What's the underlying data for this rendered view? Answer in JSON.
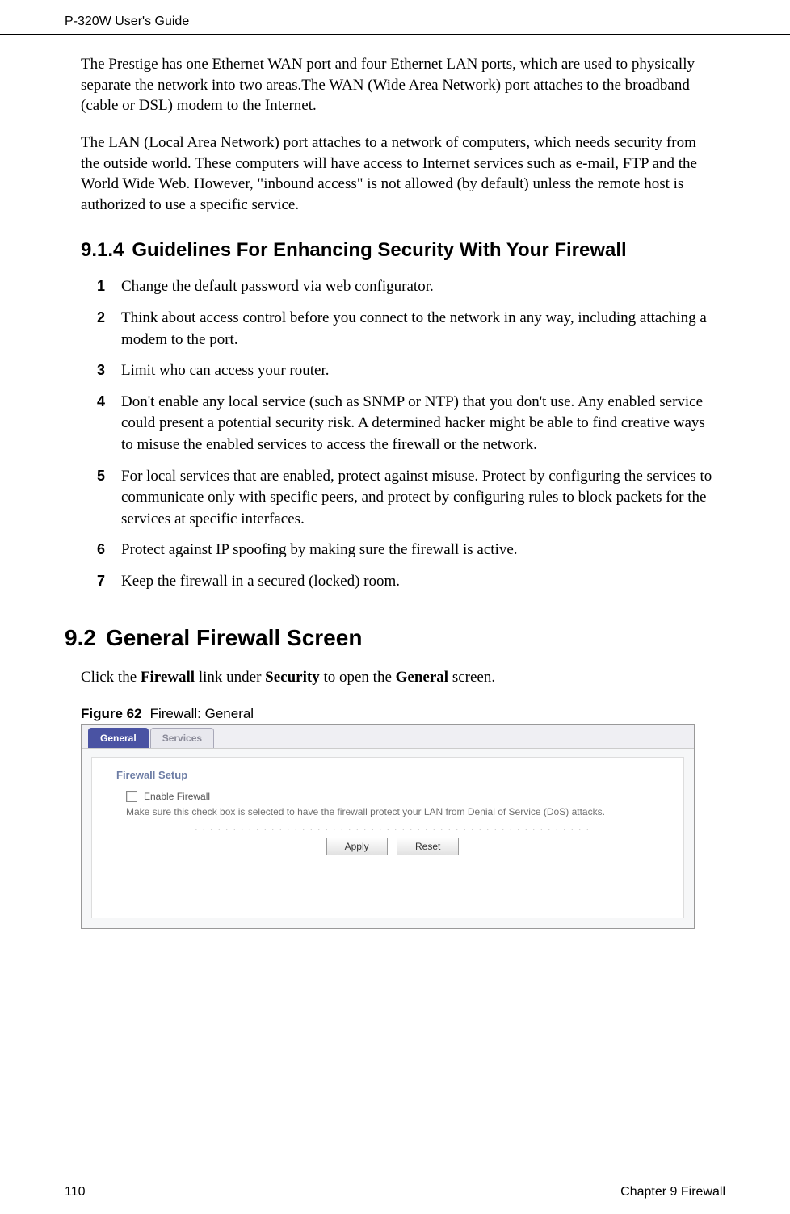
{
  "header": {
    "left": "P-320W User's Guide"
  },
  "para1": "The Prestige has one Ethernet WAN port and four Ethernet LAN ports, which are used to physically separate the network into two areas.The WAN (Wide Area Network) port attaches to the broadband (cable or DSL) modem to the Internet.",
  "para2": "The LAN (Local Area Network) port attaches to a network of computers, which needs security from the outside world. These computers will have access to Internet services such as e-mail, FTP and the World Wide Web.  However, \"inbound access\" is not allowed (by default) unless the remote host is authorized to use a specific service.",
  "section914": {
    "number": "9.1.4",
    "title": "Guidelines For Enhancing Security With Your Firewall",
    "items": [
      "Change the default password via web configurator.",
      "Think about access control before you connect to the network in any way, including attaching a modem to the port.",
      "Limit who can access your router.",
      "Don't enable any local service (such as SNMP or NTP) that you don't use. Any enabled service could present a potential security risk. A determined hacker might be able to find creative ways to misuse the enabled services to access the firewall or the network.",
      "For local services that are enabled, protect against misuse. Protect by configuring the services to communicate only with specific peers, and protect by configuring rules to block packets for the services at specific interfaces.",
      "Protect against IP spoofing by making sure the firewall is active.",
      "Keep the firewall in a secured (locked) room."
    ]
  },
  "section92": {
    "number": "9.2",
    "title": "General Firewall Screen",
    "intro_pre": "Click the ",
    "intro_b1": "Firewall",
    "intro_mid1": " link under ",
    "intro_b2": "Security",
    "intro_mid2": " to open the ",
    "intro_b3": "General",
    "intro_post": " screen."
  },
  "figure": {
    "label": "Figure 62",
    "caption": "Firewall: General"
  },
  "screenshot": {
    "tabs": {
      "active": "General",
      "inactive": "Services"
    },
    "panel_title": "Firewall Setup",
    "checkbox_label": "Enable Firewall",
    "description": "Make sure this check box is selected to have the firewall protect your LAN from Denial of Service (DoS) attacks.",
    "buttons": {
      "apply": "Apply",
      "reset": "Reset"
    }
  },
  "footer": {
    "page": "110",
    "chapter": "Chapter 9 Firewall"
  }
}
